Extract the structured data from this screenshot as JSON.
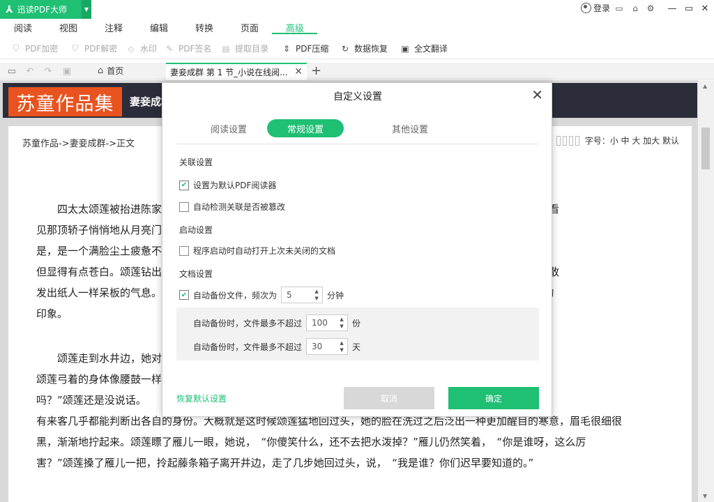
{
  "colors": {
    "accent": "#1fbf74",
    "header_bg": "#2b2d3a",
    "logo_bg": "#e8531f"
  },
  "titlebar": {
    "logo": "⅄",
    "app_name": "迅读PDF大师",
    "dropdown": "▼",
    "login": "登录"
  },
  "menu": [
    "阅读",
    "视图",
    "注释",
    "编辑",
    "转换",
    "页面",
    "高级"
  ],
  "ribbon": [
    {
      "label": "PDF加密",
      "icon": "shield-icon",
      "glyph": "⛉"
    },
    {
      "label": "PDF解密",
      "icon": "shield-unlock-icon",
      "glyph": "⛉"
    },
    {
      "label": "水印",
      "icon": "drop-icon",
      "glyph": "◇"
    },
    {
      "label": "PDF签名",
      "icon": "pen-icon",
      "glyph": "✎"
    },
    {
      "label": "提取目录",
      "icon": "doc-list-icon",
      "glyph": "▤"
    },
    {
      "label": "PDF压缩",
      "icon": "compress-icon",
      "glyph": "⇕"
    },
    {
      "label": "数据恢复",
      "icon": "recover-icon",
      "glyph": "↻"
    },
    {
      "label": "全文翻译",
      "icon": "translate-icon",
      "glyph": "▣"
    }
  ],
  "tabs": {
    "home": "首页",
    "doc": "妻妾成群 第 1 节_小说在线阅...",
    "close": "✕",
    "add": "+"
  },
  "site": {
    "logo": "苏童作品集",
    "title": "妻妾成群",
    "breadcrumb": "苏童作品->妻妾成群->正文",
    "font_label": "字号：小 中 大 加大  默认"
  },
  "doc_lines": [
    "　　四太太颂莲被抬进陈家　　　　　　　　　　　　　　　　　　　　　　　　　　　　正在井边洗旧毛线，看",
    "见那顶轿子悄悄地从月亮门　　　　　　　　　　　　　　　　　　　　　　　　　　　　家了，迎上去一看不",
    "是，是一个满脸尘土疲惫不　　　　　　　　　　　　　　　　　　　　　　　　　　　　是圆圆的，不施脂粉，",
    "但显得有点苍白。颂莲钻出　　　　　　　　　　　　　　　　　　　　　　　　　　　　莲的身影单薄纤细，散",
    "发出纸人一样呆板的气息。　　　　　　　　　　　　　　　　　　　　　　　　　　　　点给他们留下了深刻的",
    "印象。"
  ],
  "doc_lines2": [
    "　　颂莲走到水井边，她对　　　　　　　　　　　　　　　　　　　　　　　　　　　　看着她把脸埋进水里，",
    "颂莲弓着的身体像腰鼓一样　　　　　　　　　　　　　　　　　　　　　　　　　　　　说，　“水太凉是",
    "吗？”颂莲还是没说话。　　　　　　　　　　　　　　　　　　　　　　　　　　　　　亲戚。他们对陈家的所",
    "有来客几乎都能判断出各自的身份。大概就是这时候颂莲猛地回过头，她的脸在洗过之后泛出一种更加醒目的寒意，眉毛很细很",
    "黑，渐渐地拧起来。颂莲瞟了雁儿一眼，她说，　“你傻笑什么，还不去把水泼掉？”雁儿仍然笑着，　“你是谁呀，这么厉",
    "害？”颂莲搡了雁儿一把，拎起藤条箱子离开井边，走了几步她回过头，说，　“我是谁？你们迟早要知道的。”"
  ],
  "modal": {
    "title": "自定义设置",
    "close": "✕",
    "tabs": [
      "阅读设置",
      "常规设置",
      "其他设置"
    ],
    "sections": {
      "assoc": "关联设置",
      "startup": "启动设置",
      "document": "文档设置"
    },
    "options": {
      "default_reader": "设置为默认PDF阅读器",
      "auto_detect": "自动检测关联是否被篡改",
      "reopen": "程序启动时自动打开上次未关闭的文档",
      "auto_backup": "自动备份文件，频次为",
      "minutes": "分钟",
      "max_size": "自动备份时，文件最多不超过",
      "size_unit": "份",
      "max_days": "自动备份时，文件最多不超过",
      "days_unit": "天"
    },
    "values": {
      "freq": "5",
      "count": "100",
      "days": "30"
    },
    "restore": "恢复默认设置",
    "cancel": "取消",
    "ok": "确定"
  }
}
